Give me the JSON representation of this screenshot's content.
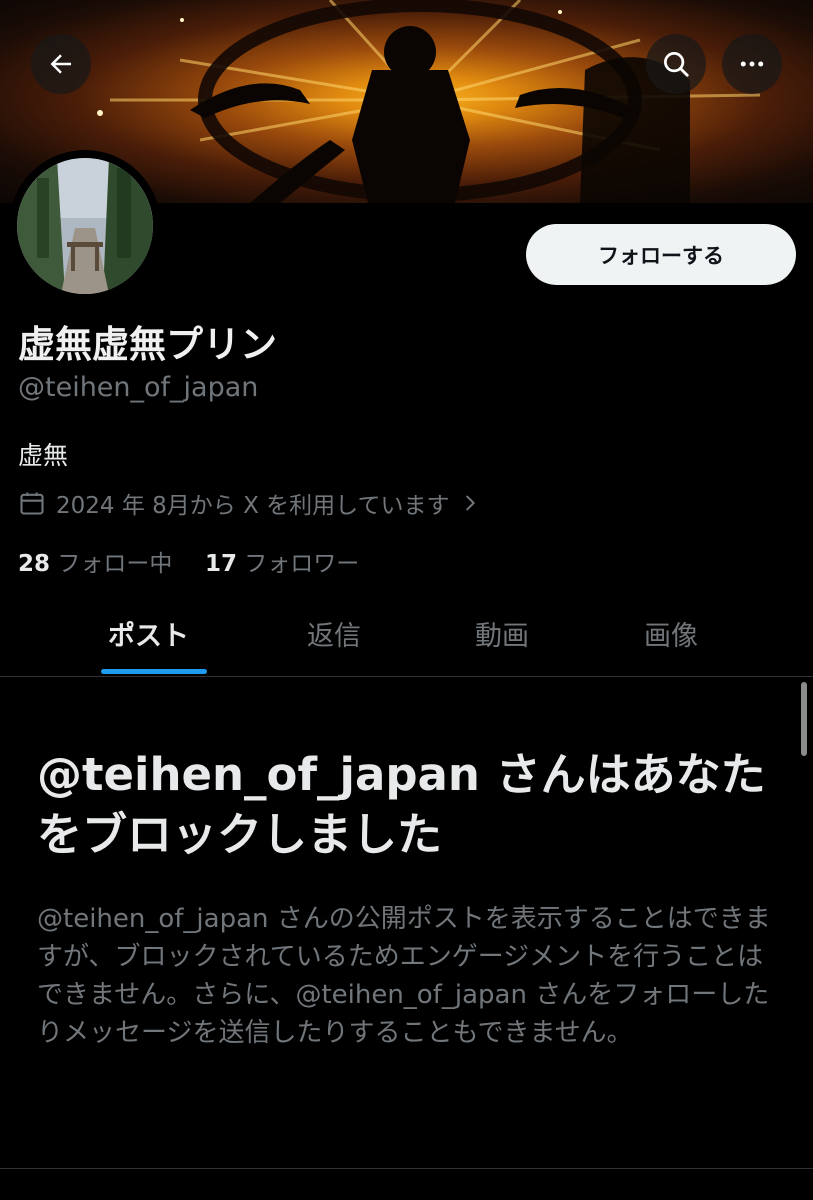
{
  "header": {
    "back_icon": "arrow-left-icon",
    "search_icon": "search-icon",
    "more_icon": "more-horizontal-icon"
  },
  "profile": {
    "follow_button_label": "フォローする",
    "display_name": "虚無虚無プリン",
    "handle": "@teihen_of_japan",
    "bio": "虚無",
    "joined_icon": "calendar-icon",
    "joined_text": "2024 年 8月から X を利用しています",
    "following_count": "28",
    "following_label": "フォロー中",
    "followers_count": "17",
    "followers_label": "フォロワー"
  },
  "tabs": [
    "ポスト",
    "返信",
    "動画",
    "画像"
  ],
  "active_tab": "ポスト",
  "blocked": {
    "title": "@teihen_of_japan さんはあなたをブロックしました",
    "description": "@teihen_of_japan さんの公開ポストを表示することはできますが、ブロックされているためエンゲージメントを行うことはできません。さらに、@teihen_of_japan さんをフォローしたりメッセージを送信したりすることもできません。"
  },
  "colors": {
    "background": "#000000",
    "accent": "#1d9bf0",
    "text_primary": "#e7e9ea",
    "text_secondary": "#71767b"
  }
}
